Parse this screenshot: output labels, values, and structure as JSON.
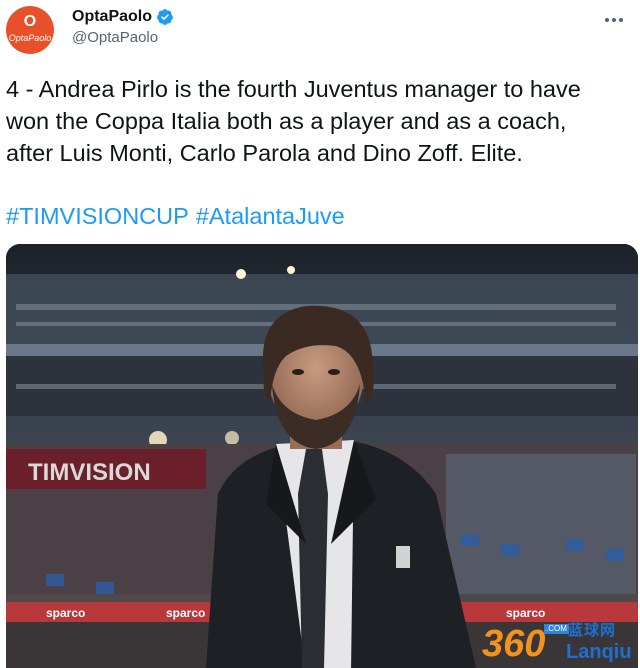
{
  "account": {
    "display_name": "OptaPaolo",
    "handle": "@OptaPaolo",
    "avatar_text": "O",
    "avatar_brand": "OptaPaolo",
    "verified": true
  },
  "tweet": {
    "text": "4 - Andrea Pirlo is the fourth Juventus manager to have\nwon the Coppa Italia both as a player and as a coach,\nafter Luis Monti, Carlo Parola and Dino Zoff. Elite.",
    "hashtags": [
      "#TIMVISIONCUP",
      "#AtalantaJuve"
    ]
  },
  "media": {
    "stadium_sign": "TIMVISION",
    "board_text": "sparco"
  },
  "watermark": {
    "number": "360",
    "domain_tag": ".COM",
    "chinese": "蓝球网",
    "english": "Lanqiu"
  },
  "colors": {
    "link": "#1d9bf0",
    "verified": "#1d9bf0",
    "avatar": "#e8502a",
    "watermark_orange": "#f3931d",
    "watermark_blue": "#1f6fd1"
  }
}
